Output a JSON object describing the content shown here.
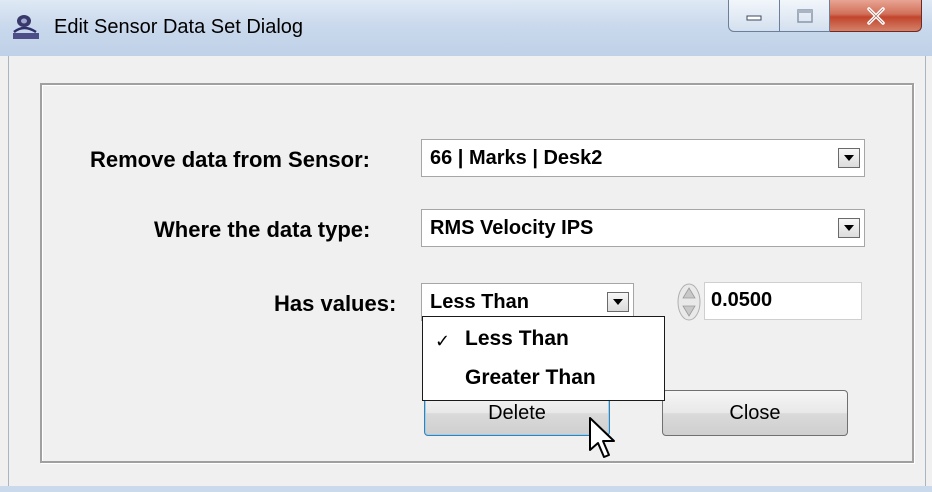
{
  "window": {
    "title": "Edit Sensor Data Set Dialog",
    "icon": "app-logo-icon",
    "caption_buttons": [
      "minimize-icon",
      "maximize-icon",
      "close-icon"
    ]
  },
  "form": {
    "sensor": {
      "label": "Remove data from Sensor:",
      "value": "66 | Marks | Desk2"
    },
    "data_type": {
      "label": "Where the data type:",
      "value": "RMS Velocity IPS"
    },
    "has_values": {
      "label": "Has values:",
      "comparison": "Less Than",
      "threshold": "0.0500",
      "options": [
        {
          "label": "Less Than",
          "checked": "✓"
        },
        {
          "label": "Greater Than",
          "checked": ""
        }
      ]
    }
  },
  "buttons": {
    "delete": "Delete",
    "close": "Close"
  },
  "colors": {
    "title_gradient": "#cad9ec",
    "close_button": "#c2452c",
    "default_button_border": "#3c7fb1"
  }
}
